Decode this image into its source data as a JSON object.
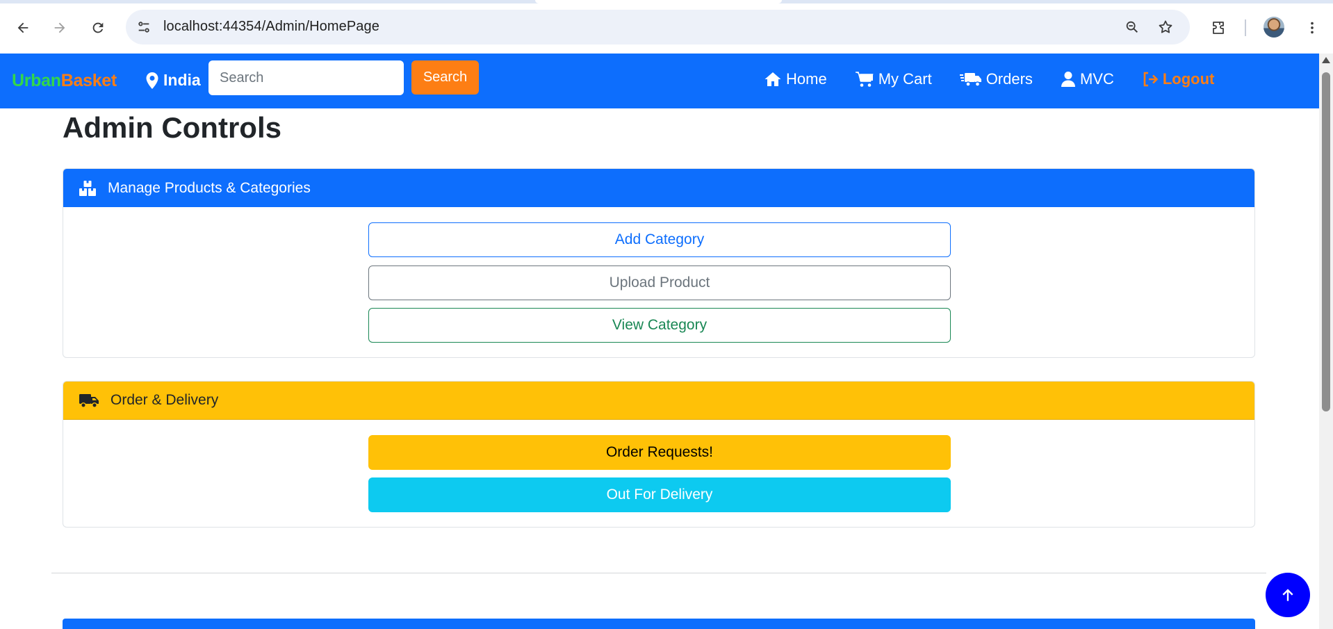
{
  "browser": {
    "url": "localhost:44354/Admin/HomePage"
  },
  "navbar": {
    "brand_part1": "Urban",
    "brand_part2": "Basket",
    "location": "India",
    "search_placeholder": "Search",
    "search_button": "Search",
    "links": {
      "home": "Home",
      "cart": "My Cart",
      "orders": "Orders",
      "profile": "MVC",
      "logout": "Logout"
    }
  },
  "main": {
    "title": "Admin Controls",
    "products_card": {
      "header": "Manage Products & Categories",
      "buttons": {
        "add_category": "Add Category",
        "upload_product": "Upload Product",
        "view_category": "View Category"
      }
    },
    "orders_card": {
      "header": "Order & Delivery",
      "buttons": {
        "order_requests": "Order Requests!",
        "out_for_delivery": "Out For Delivery"
      }
    }
  },
  "colors": {
    "primary": "#0d6efd",
    "brand_green": "#32d74b",
    "brand_orange": "#fd7e14",
    "warning": "#ffc107",
    "info": "#0dcaf0",
    "back_to_top": "#0000ff"
  }
}
